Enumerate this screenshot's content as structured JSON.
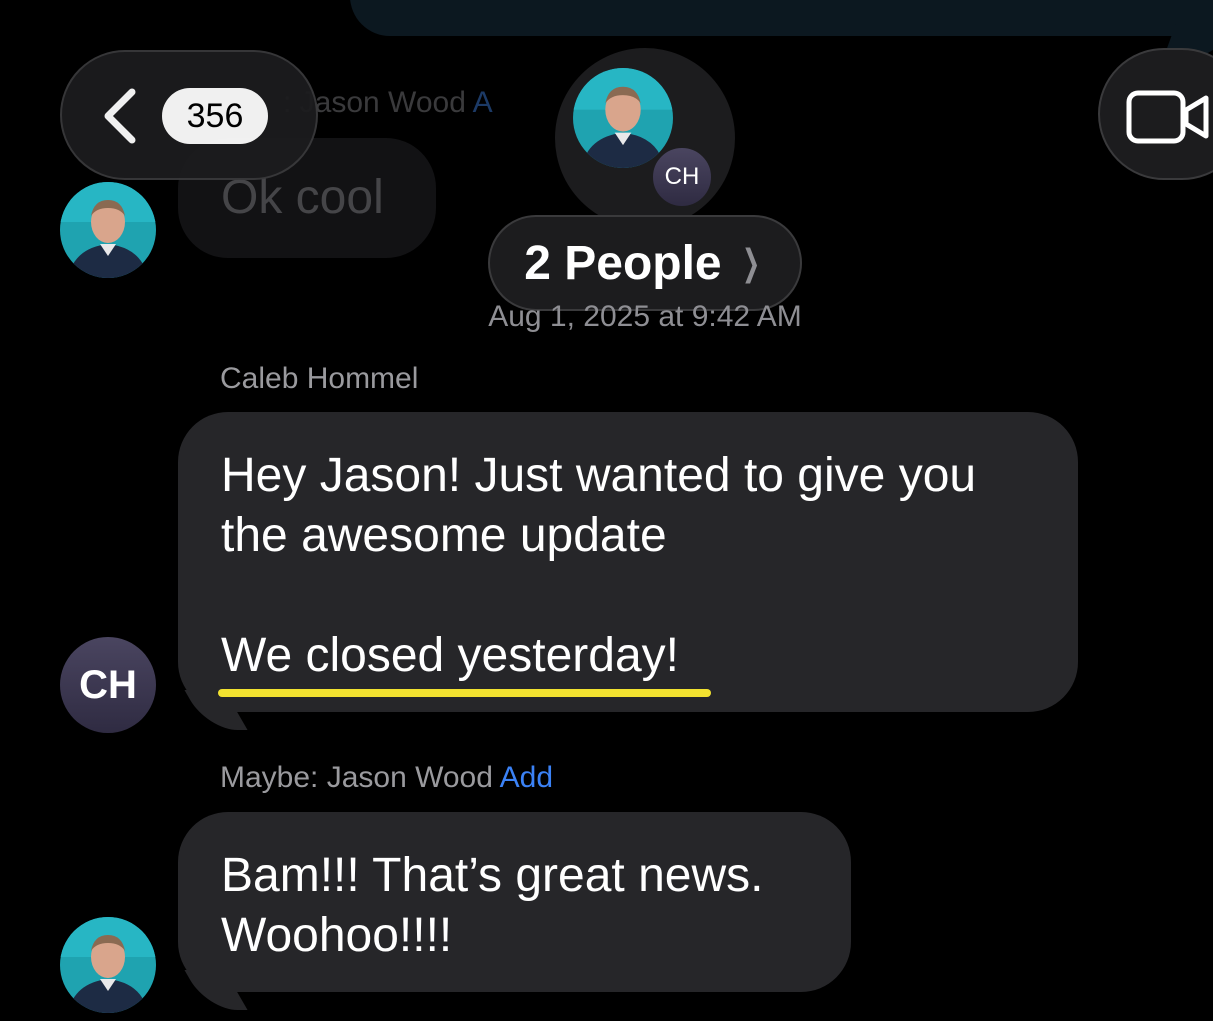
{
  "header": {
    "unread_count": "356",
    "group_initials": "CH",
    "people_label": "2 People",
    "back_icon": "chevron-left-icon",
    "video_icon": "video-camera-icon"
  },
  "previous": {
    "sender_fragment": ": Jason Wood",
    "add_fragment": "A",
    "message": "Ok cool"
  },
  "timestamp": "Aug 1, 2025 at 9:42 AM",
  "messages": [
    {
      "sender": "Caleb Hommel",
      "avatar_initials": "CH",
      "text": "Hey Jason! Just wanted to give you\nthe awesome update\n\nWe closed yesterday!"
    },
    {
      "sender_prefix": "Maybe: Jason Wood",
      "sender_action": "Add",
      "text": "Bam!!! That’s great news.\nWoohoo!!!!"
    }
  ],
  "colors": {
    "background": "#000000",
    "bubble": "#262629",
    "link": "#3b82f6",
    "highlight": "#f2e230"
  }
}
